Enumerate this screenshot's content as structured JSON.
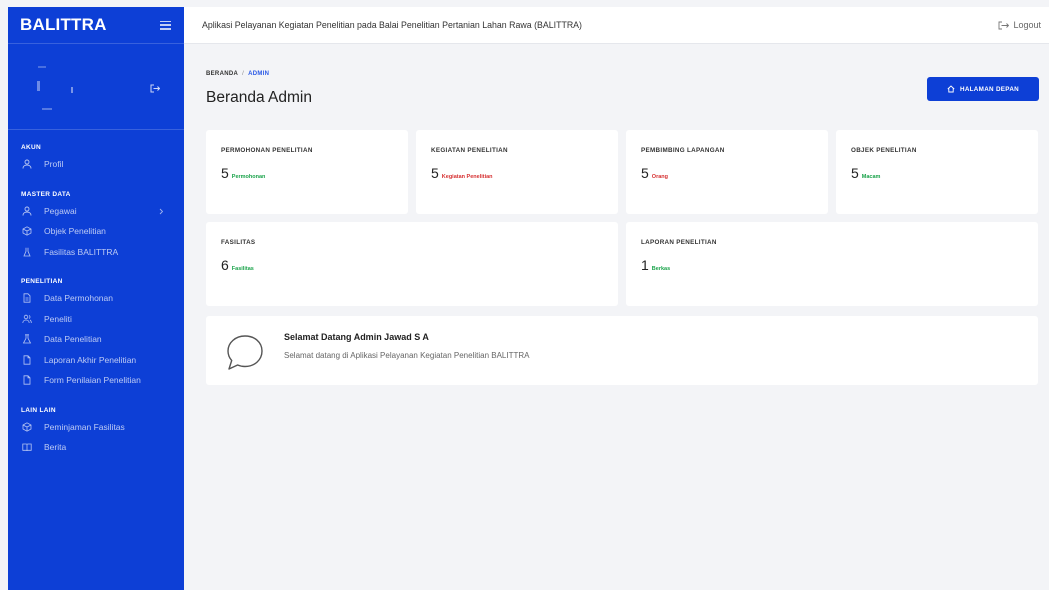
{
  "sidebar": {
    "brand": "BALITTRA",
    "sections": [
      {
        "title": "AKUN",
        "items": [
          {
            "label": "Profil",
            "icon": "user-icon"
          }
        ]
      },
      {
        "title": "MASTER DATA",
        "items": [
          {
            "label": "Pegawai",
            "icon": "user-icon"
          },
          {
            "label": "Objek Penelitian",
            "icon": "box-icon"
          },
          {
            "label": "Fasilitas BALITTRA",
            "icon": "flask-icon"
          }
        ]
      },
      {
        "title": "PENELITIAN",
        "items": [
          {
            "label": "Data Permohonan",
            "icon": "file-icon"
          },
          {
            "label": "Peneliti",
            "icon": "users-icon"
          },
          {
            "label": "Data Penelitian",
            "icon": "flask-icon"
          },
          {
            "label": "Laporan Akhir Penelitian",
            "icon": "document-icon"
          },
          {
            "label": "Form Penilaian Penelitian",
            "icon": "document-icon"
          }
        ]
      },
      {
        "title": "LAIN LAIN",
        "items": [
          {
            "label": "Peminjaman Fasilitas",
            "icon": "box-icon"
          },
          {
            "label": "Berita",
            "icon": "book-icon"
          }
        ]
      }
    ]
  },
  "topbar": {
    "title": "Aplikasi Pelayanan Kegiatan Penelitian pada Balai Penelitian Pertanian Lahan Rawa (BALITTRA)",
    "logout": "Logout"
  },
  "breadcrumb": {
    "home": "BERANDA",
    "separator": "/",
    "current": "ADMIN"
  },
  "page_title": "Beranda Admin",
  "home_button": "HALAMAN DEPAN",
  "stats": [
    {
      "title": "PERMOHONAN PENELITIAN",
      "value": "5",
      "unit": "Permohonan",
      "unit_color": "#1aa34a"
    },
    {
      "title": "KEGIATAN PENELITIAN",
      "value": "5",
      "unit": "Kegiatan Penelitian",
      "unit_color": "#d63031"
    },
    {
      "title": "PEMBIMBING LAPANGAN",
      "value": "5",
      "unit": "Orang",
      "unit_color": "#d63031"
    },
    {
      "title": "OBJEK PENELITIAN",
      "value": "5",
      "unit": "Macam",
      "unit_color": "#1aa34a"
    },
    {
      "title": "FASILITAS",
      "value": "6",
      "unit": "Fasilitas",
      "unit_color": "#1aa34a"
    },
    {
      "title": "LAPORAN PENELITIAN",
      "value": "1",
      "unit": "Berkas",
      "unit_color": "#1aa34a"
    }
  ],
  "welcome": {
    "title": "Selamat Datang Admin Jawad S A",
    "subtitle": "Selamat datang di Aplikasi Pelayanan Kegiatan Penelitian BALITTRA"
  },
  "colors": {
    "primary": "#0d3fd6",
    "background": "#f3f4f7",
    "success": "#1aa34a",
    "danger": "#d63031"
  }
}
